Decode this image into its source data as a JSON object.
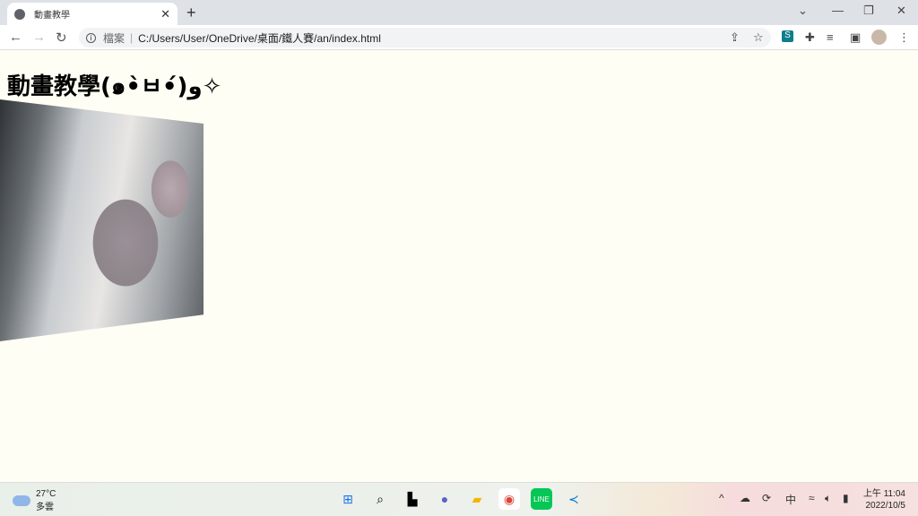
{
  "browser": {
    "tab_title": "動畫教學",
    "url_label": "檔案",
    "url": "C:/Users/User/OneDrive/桌面/鐵人賽/an/index.html"
  },
  "page": {
    "heading": "動畫教學(๑•̀ㅂ•́)و✧"
  },
  "taskbar": {
    "temperature": "27°C",
    "weather": "多雲",
    "ime": "中",
    "time": "上午 11:04",
    "date": "2022/10/5"
  }
}
